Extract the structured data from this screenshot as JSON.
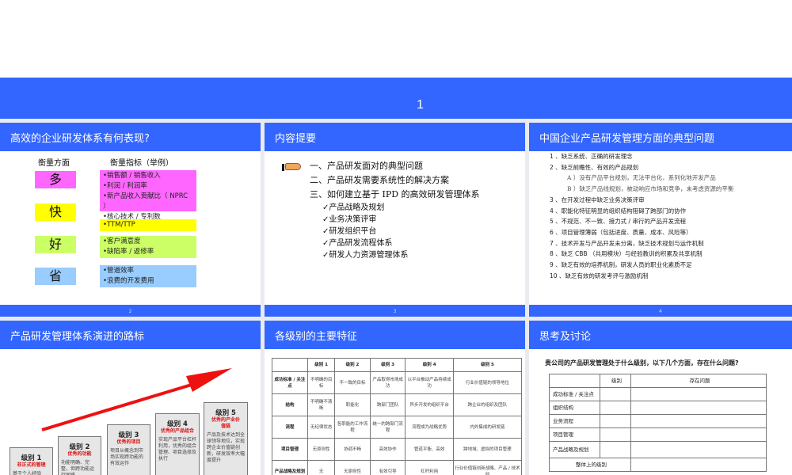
{
  "banner": {
    "page": "1"
  },
  "slides": [
    {
      "title": "高效的企业研发体系有何表现?",
      "footer": "2",
      "col1": "衡量方面",
      "col2": "衡量指标（举例）",
      "rows": [
        {
          "aspect": "多",
          "color": "#ff66ff",
          "metrics": [
            "•销售额 / 销售收入",
            "•利润 / 利润率",
            "•新产品收入贡献比（ NPRC ）",
            "•核心技术 / 专利数"
          ]
        },
        {
          "aspect": "快",
          "color": "#ffff00",
          "metrics": [
            "•TTM/TTP"
          ]
        },
        {
          "aspect": "好",
          "color": "#ccff66",
          "metrics": [
            "•客户满意度",
            "•缺陷率 / 返修率"
          ]
        },
        {
          "aspect": "省",
          "color": "#99ccff",
          "metrics": [
            "•管道效率",
            "•浪费的开发费用"
          ]
        }
      ]
    },
    {
      "title": "内容提要",
      "footer": "3",
      "main": [
        "一、产品研发面对的典型问题",
        "二、产品研发需要系统性的解决方案",
        "三、如何建立基于 IPD 的高效研发管理体系"
      ],
      "sub": [
        "✓产品战略及规划",
        "✓业务决策评审",
        "✓研发组织平台",
        "✓产品研发流程体系",
        "✓研发人力资源管理体系"
      ]
    },
    {
      "title": "中国企业产品研发管理方面的典型问题",
      "footer": "4",
      "items": [
        "1 、缺乏系统、正确的研发理念",
        "2 、缺乏前瞻性、有效的产品规划",
        "A ）没有产品平台规划，无法平台化、系列化地开发产品",
        "B ）缺乏产品线规划，被动响应市场和竞争，未考虑资源的平衡",
        "3 、在开发过程中缺乏业务决策评审",
        "4 、职能化特征明显的组织结构阻碍了跨部门的协作",
        "5 、不规范、不一致、接力式 / 串行的产品开发流程",
        "6 、项目管理薄弱（包括进度、质量、成本、风险等）",
        "7 、技术开发与产品开发未分离，缺乏技术规划与运作机制",
        "8 、缺乏 CBB （共用模块）与经验教训的积累及共享机制",
        "9 、缺乏有效的培养机制，研发人员的职业化素质不足",
        "10 、缺乏有效的研发考评与激励机制"
      ]
    },
    {
      "title": "产品研发管理体系演进的路标",
      "steps": [
        {
          "level": "级别 1",
          "name": "非正式的管理",
          "desc": "基于个人经验（项目英雄主义）"
        },
        {
          "level": "级别 2",
          "name": "优秀的功能",
          "desc": "功能明确、完整，但跨功能运行困难"
        },
        {
          "level": "级别 3",
          "name": "优秀的项目",
          "desc": "项目从概念到市场实现跨功能的有效运作"
        },
        {
          "level": "级别 4",
          "name": "优秀的产品组合",
          "desc": "实现产品平台杠杆利用，优秀的组合管理、项目选择及执行"
        },
        {
          "level": "级别 5",
          "name": "优秀的产业价值链",
          "desc": "产品及技术达到全球领导地位，实现跨企业价值链创新，研发效率大幅度提升"
        }
      ]
    },
    {
      "title": "各级别的主要特征",
      "header": [
        "",
        "级别 1",
        "级别 2",
        "级别 3",
        "级别 4",
        "级别 5"
      ],
      "rows": [
        [
          "成功标准 / 关注点",
          "不明确的目标",
          "不一致的目标",
          "产品取得市场成功",
          "以平台推动产品持续成功",
          "行业价值链的领导地位"
        ],
        [
          "结构",
          "不明确不清晰",
          "职能化",
          "跨部门团队",
          "异步开发的组织平台",
          "跨企业的组织及团队"
        ],
        [
          "流程",
          "无纪律状态",
          "各职能的工作流程",
          "统一的跨部门流程",
          "流程成为战略优势",
          "内外集成的研发链"
        ],
        [
          "项目管理",
          "无原则性",
          "协调不畅",
          "高效协作",
          "管道平衡、高效",
          "跨地域、虚拟的项目管理"
        ],
        [
          "产品战略及规划",
          "无",
          "无原则性",
          "有效引导",
          "杠杆利用",
          "行业价值链创新战略、产品 / 技术创"
        ]
      ]
    },
    {
      "title": "思考及讨论",
      "question": "贵公司的产品研发管理处于什么级别，以下几个方面，存在什么问题?",
      "header": [
        "",
        "级别",
        "存在问题"
      ],
      "rows": [
        "成功标准 / 关注点",
        "组织结构",
        "业务流程",
        "项目管理",
        "产品战略及规划"
      ],
      "total": "整体上的级别"
    }
  ]
}
